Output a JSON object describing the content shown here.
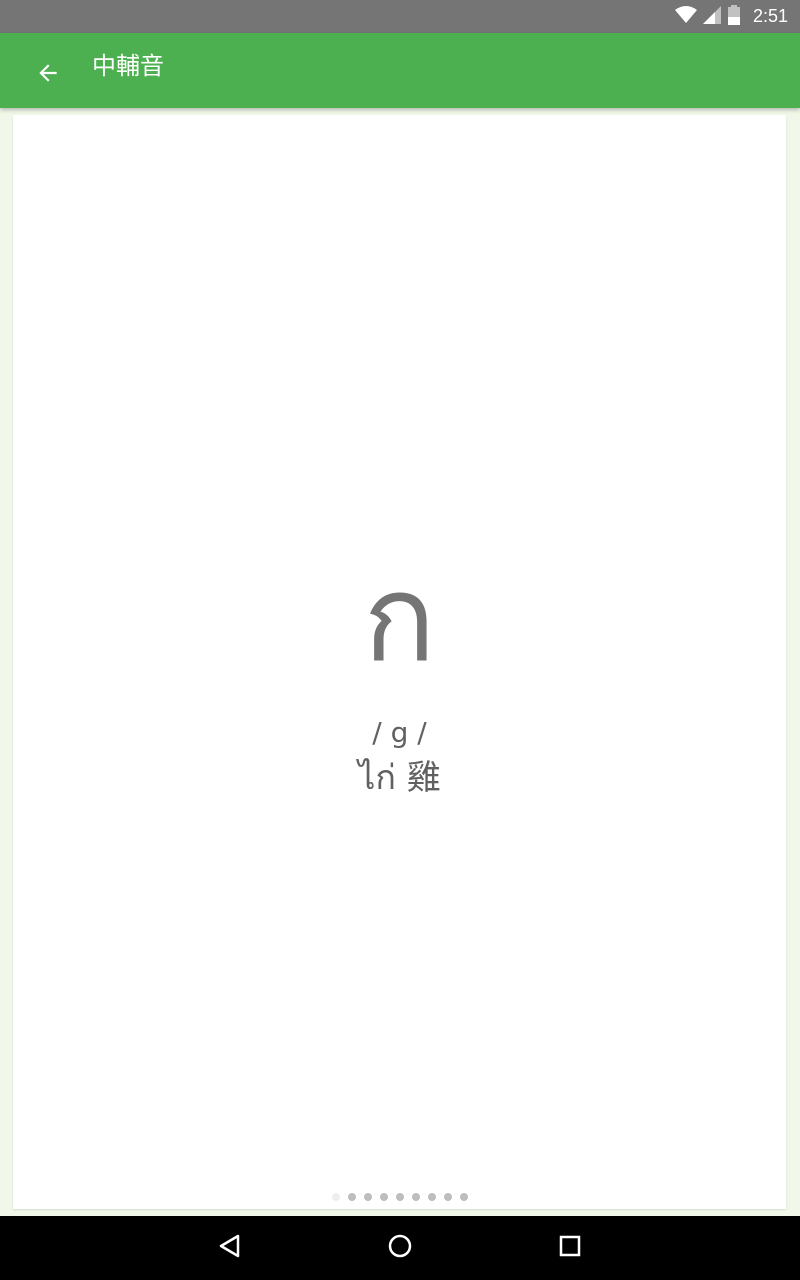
{
  "status_bar": {
    "time": "2:51",
    "icons": [
      "wifi-icon",
      "cell-signal-icon",
      "battery-icon"
    ]
  },
  "app_bar": {
    "title": "中輔音",
    "back_icon": "arrow-back-icon",
    "color": "#4caf50"
  },
  "card": {
    "letter": "ก",
    "phonetic": "/ g /",
    "example": "ไก่ 雞"
  },
  "pager": {
    "total_pages": 9,
    "active_index": 0
  },
  "nav_bar": {
    "buttons": [
      "back-triangle-icon",
      "home-circle-icon",
      "recents-square-icon"
    ]
  }
}
